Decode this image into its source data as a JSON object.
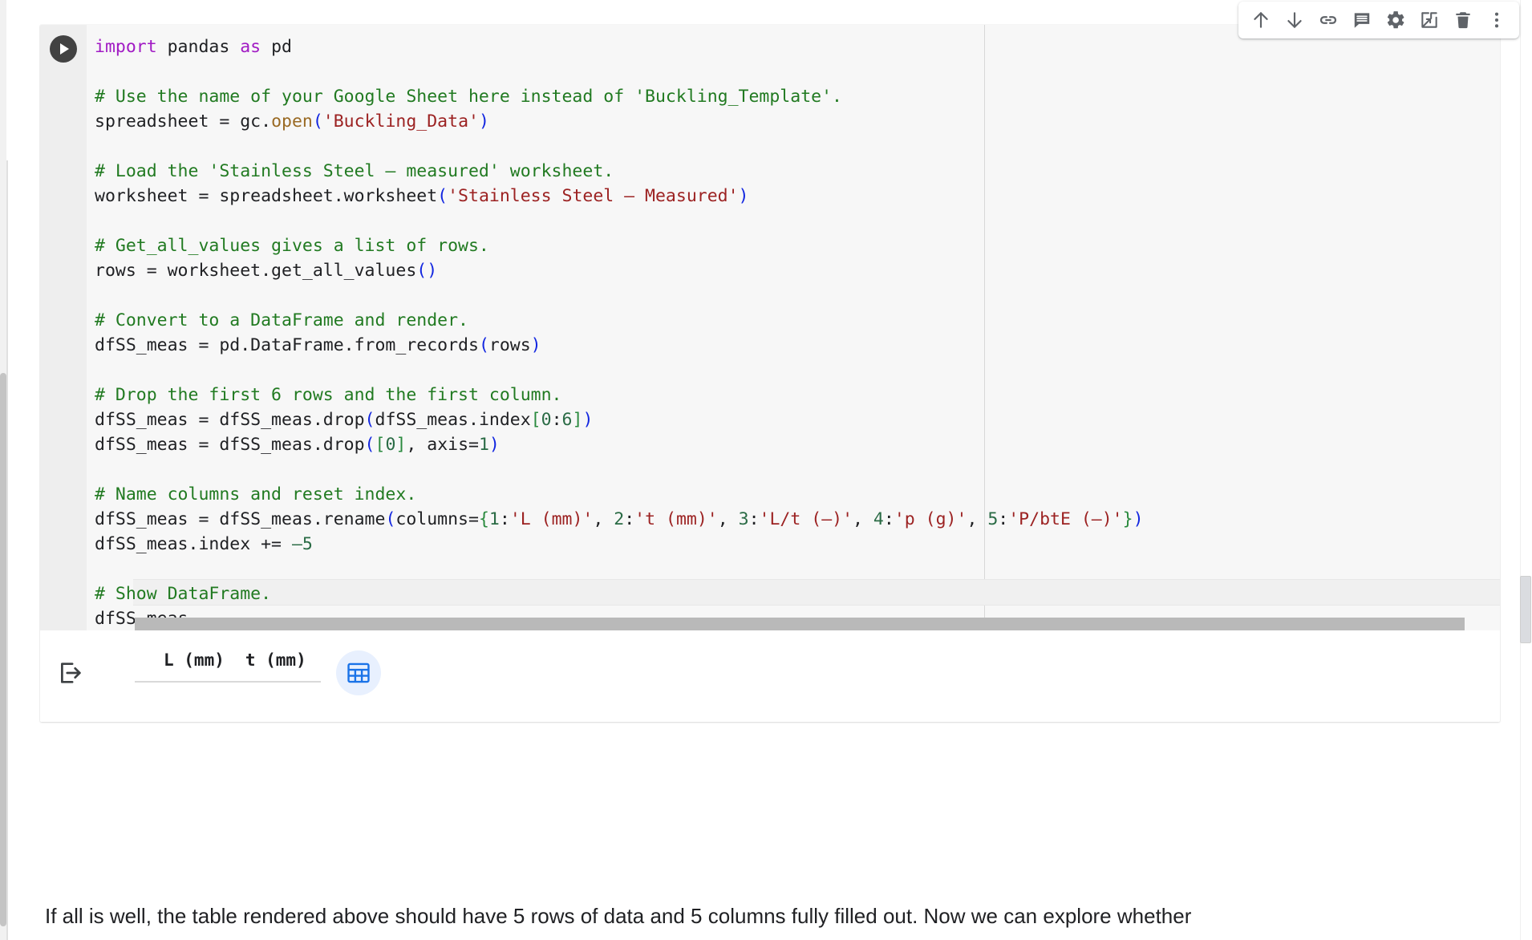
{
  "toolbar": {
    "buttons": [
      {
        "name": "move-cell-up-icon",
        "label": "Move cell up"
      },
      {
        "name": "move-cell-down-icon",
        "label": "Move cell down"
      },
      {
        "name": "link-to-cell-icon",
        "label": "Link to cell"
      },
      {
        "name": "add-comment-icon",
        "label": "Add a comment"
      },
      {
        "name": "cell-settings-icon",
        "label": "Cell settings"
      },
      {
        "name": "mirror-cell-in-tab-icon",
        "label": "Mirror cell in tab"
      },
      {
        "name": "delete-cell-icon",
        "label": "Delete cell"
      },
      {
        "name": "more-cell-actions-icon",
        "label": "More cell actions"
      }
    ]
  },
  "cell": {
    "run_button_label": "Run cell",
    "code_lines": [
      [
        {
          "t": "import ",
          "c": "kw"
        },
        {
          "t": "pandas ",
          "c": ""
        },
        {
          "t": "as ",
          "c": "kw"
        },
        {
          "t": "pd",
          "c": ""
        }
      ],
      [
        {
          "t": "",
          "c": ""
        }
      ],
      [
        {
          "t": "# Use the name of your Google Sheet here instead of 'Buckling_Template'.",
          "c": "cmt"
        }
      ],
      [
        {
          "t": "spreadsheet = gc.",
          "c": ""
        },
        {
          "t": "open",
          "c": "fn"
        },
        {
          "t": "(",
          "c": "par"
        },
        {
          "t": "'Buckling_Data'",
          "c": "str"
        },
        {
          "t": ")",
          "c": "par"
        }
      ],
      [
        {
          "t": "",
          "c": ""
        }
      ],
      [
        {
          "t": "# Load the 'Stainless Steel – measured' worksheet.",
          "c": "cmt"
        }
      ],
      [
        {
          "t": "worksheet = spreadsheet.worksheet",
          "c": ""
        },
        {
          "t": "(",
          "c": "par"
        },
        {
          "t": "'Stainless Steel – Measured'",
          "c": "str"
        },
        {
          "t": ")",
          "c": "par"
        }
      ],
      [
        {
          "t": "",
          "c": ""
        }
      ],
      [
        {
          "t": "# Get_all_values gives a list of rows.",
          "c": "cmt"
        }
      ],
      [
        {
          "t": "rows = worksheet.get_all_values",
          "c": ""
        },
        {
          "t": "()",
          "c": "par"
        }
      ],
      [
        {
          "t": "",
          "c": ""
        }
      ],
      [
        {
          "t": "# Convert to a DataFrame and render.",
          "c": "cmt"
        }
      ],
      [
        {
          "t": "dfSS_meas = pd.DataFrame.from_records",
          "c": ""
        },
        {
          "t": "(",
          "c": "par"
        },
        {
          "t": "rows",
          "c": ""
        },
        {
          "t": ")",
          "c": "par"
        }
      ],
      [
        {
          "t": "",
          "c": ""
        }
      ],
      [
        {
          "t": "# Drop the first 6 rows and the first column.",
          "c": "cmt"
        }
      ],
      [
        {
          "t": "dfSS_meas = dfSS_meas.drop",
          "c": ""
        },
        {
          "t": "(",
          "c": "par"
        },
        {
          "t": "dfSS_meas.index",
          "c": ""
        },
        {
          "t": "[",
          "c": "brc"
        },
        {
          "t": "0",
          "c": "num"
        },
        {
          "t": ":",
          "c": ""
        },
        {
          "t": "6",
          "c": "num"
        },
        {
          "t": "]",
          "c": "brc"
        },
        {
          "t": ")",
          "c": "par"
        }
      ],
      [
        {
          "t": "dfSS_meas = dfSS_meas.drop",
          "c": ""
        },
        {
          "t": "(",
          "c": "par"
        },
        {
          "t": "[",
          "c": "brc"
        },
        {
          "t": "0",
          "c": "num"
        },
        {
          "t": "]",
          "c": "brc"
        },
        {
          "t": ", axis=",
          "c": ""
        },
        {
          "t": "1",
          "c": "num"
        },
        {
          "t": ")",
          "c": "par"
        }
      ],
      [
        {
          "t": "",
          "c": ""
        }
      ],
      [
        {
          "t": "# Name columns and reset index.",
          "c": "cmt"
        }
      ],
      [
        {
          "t": "dfSS_meas = dfSS_meas.rename",
          "c": ""
        },
        {
          "t": "(",
          "c": "par"
        },
        {
          "t": "columns=",
          "c": ""
        },
        {
          "t": "{",
          "c": "brc"
        },
        {
          "t": "1",
          "c": "num"
        },
        {
          "t": ":",
          "c": ""
        },
        {
          "t": "'L (mm)'",
          "c": "str"
        },
        {
          "t": ", ",
          "c": ""
        },
        {
          "t": "2",
          "c": "num"
        },
        {
          "t": ":",
          "c": ""
        },
        {
          "t": "'t (mm)'",
          "c": "str"
        },
        {
          "t": ", ",
          "c": ""
        },
        {
          "t": "3",
          "c": "num"
        },
        {
          "t": ":",
          "c": ""
        },
        {
          "t": "'L/t (–)'",
          "c": "str"
        },
        {
          "t": ", ",
          "c": ""
        },
        {
          "t": "4",
          "c": "num"
        },
        {
          "t": ":",
          "c": ""
        },
        {
          "t": "'p (g)'",
          "c": "str"
        },
        {
          "t": ", ",
          "c": ""
        },
        {
          "t": "5",
          "c": "num"
        },
        {
          "t": ":",
          "c": ""
        },
        {
          "t": "'P/btE (–)'",
          "c": "str"
        },
        {
          "t": "}",
          "c": "brc"
        },
        {
          "t": ")",
          "c": "par"
        }
      ],
      [
        {
          "t": "dfSS_meas.index += ",
          "c": ""
        },
        {
          "t": "–5",
          "c": "num"
        }
      ],
      [
        {
          "t": "",
          "c": ""
        }
      ],
      [
        {
          "t": "# Show DataFrame.",
          "c": "cmt"
        }
      ],
      [
        {
          "t": "dfSS_meas",
          "c": ""
        }
      ]
    ],
    "highlighted_line_index": 22
  },
  "output": {
    "output_icon_name": "show-output-icon",
    "dataframe_columns": [
      "L (mm)",
      "t (mm)"
    ],
    "sheet_button_label": "View as interactive table"
  },
  "page": {
    "paragraph": "If all is well, the table rendered above should have 5 rows of data and 5 columns fully filled out. Now we can explore whether"
  },
  "colors": {
    "keyword": "#a11bc4",
    "comment": "#217a21",
    "string": "#9c2222",
    "function": "#9a6a24",
    "paren": "#1226e0",
    "number": "#2a6b45",
    "accent_blue": "#1a73e8",
    "cell_bg": "#f7f7f7",
    "gutter_bg": "#eeeeee"
  }
}
